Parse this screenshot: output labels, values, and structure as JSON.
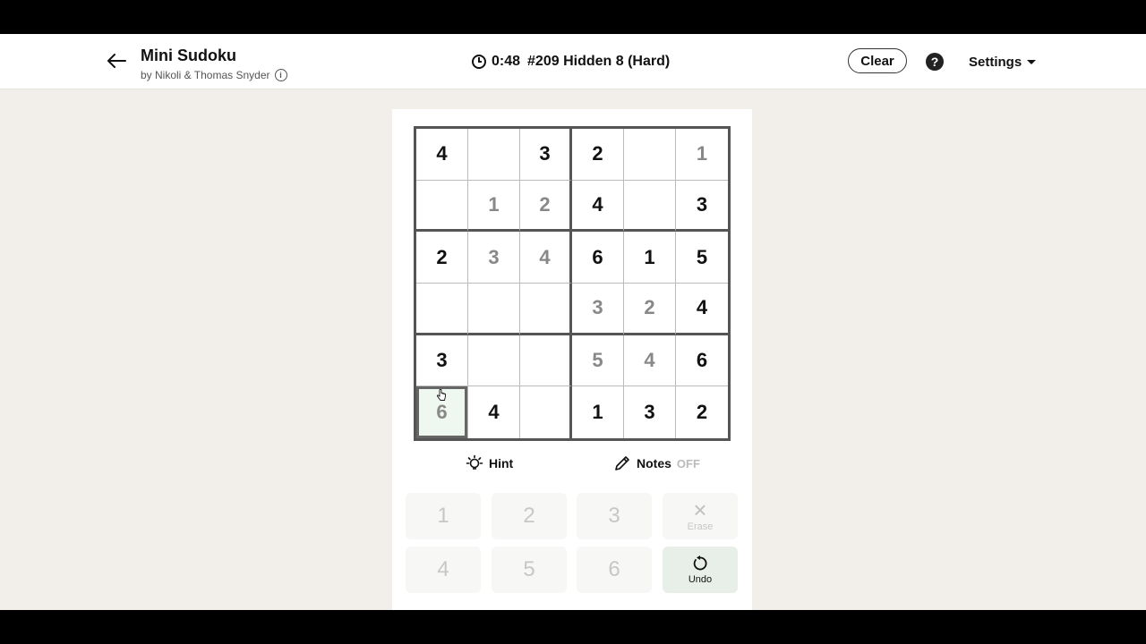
{
  "app": {
    "title": "Mini Sudoku",
    "byline": "by Nikoli & Thomas Snyder",
    "timer": "0:48",
    "puzzle": "#209 Hidden 8 (Hard)",
    "clear_label": "Clear",
    "help_label": "?",
    "settings_label": "Settings"
  },
  "grid": {
    "rows": [
      [
        {
          "v": "4",
          "given": true
        },
        {
          "v": "",
          "given": false
        },
        {
          "v": "3",
          "given": true
        },
        {
          "v": "2",
          "given": true
        },
        {
          "v": "",
          "given": false
        },
        {
          "v": "1",
          "given": false
        }
      ],
      [
        {
          "v": "",
          "given": false
        },
        {
          "v": "1",
          "given": false
        },
        {
          "v": "2",
          "given": false
        },
        {
          "v": "4",
          "given": true
        },
        {
          "v": "",
          "given": false
        },
        {
          "v": "3",
          "given": true
        }
      ],
      [
        {
          "v": "2",
          "given": true
        },
        {
          "v": "3",
          "given": false
        },
        {
          "v": "4",
          "given": false
        },
        {
          "v": "6",
          "given": true
        },
        {
          "v": "1",
          "given": true
        },
        {
          "v": "5",
          "given": true
        }
      ],
      [
        {
          "v": "",
          "given": false
        },
        {
          "v": "",
          "given": false
        },
        {
          "v": "",
          "given": false
        },
        {
          "v": "3",
          "given": false
        },
        {
          "v": "2",
          "given": false
        },
        {
          "v": "4",
          "given": true
        }
      ],
      [
        {
          "v": "3",
          "given": true
        },
        {
          "v": "",
          "given": false
        },
        {
          "v": "",
          "given": false
        },
        {
          "v": "5",
          "given": false
        },
        {
          "v": "4",
          "given": false
        },
        {
          "v": "6",
          "given": true
        }
      ],
      [
        {
          "v": "6",
          "given": false,
          "selected": true
        },
        {
          "v": "4",
          "given": true
        },
        {
          "v": "",
          "given": false
        },
        {
          "v": "1",
          "given": true
        },
        {
          "v": "3",
          "given": true
        },
        {
          "v": "2",
          "given": true
        }
      ]
    ]
  },
  "tools": {
    "hint_label": "Hint",
    "notes_label": "Notes",
    "notes_state": "OFF"
  },
  "keypad": {
    "keys": [
      "1",
      "2",
      "3",
      "4",
      "5",
      "6"
    ],
    "erase_label": "Erase",
    "undo_label": "Undo"
  },
  "colors": {
    "background": "#f2efeb",
    "selected_cell": "#eef8f0",
    "undo_bg": "#e8efe9"
  }
}
